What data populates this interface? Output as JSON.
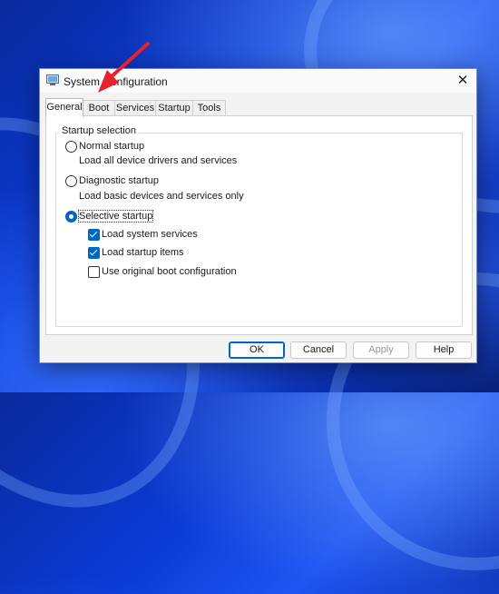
{
  "window": {
    "title": "System Configuration",
    "close_glyph": "✕"
  },
  "tabs": [
    {
      "label": "General",
      "active": true
    },
    {
      "label": "Boot",
      "active": false
    },
    {
      "label": "Services",
      "active": false
    },
    {
      "label": "Startup",
      "active": false
    },
    {
      "label": "Tools",
      "active": false
    }
  ],
  "startup_selection": {
    "group_label": "Startup selection",
    "normal": {
      "label": "Normal startup",
      "description": "Load all device drivers and services",
      "selected": false
    },
    "diagnostic": {
      "label": "Diagnostic startup",
      "description": "Load basic devices and services only",
      "selected": false
    },
    "selective": {
      "label": "Selective startup",
      "selected": true
    },
    "options": [
      {
        "label": "Load system services",
        "checked": true
      },
      {
        "label": "Load startup items",
        "checked": true
      },
      {
        "label": "Use original boot configuration",
        "checked": false
      }
    ]
  },
  "buttons": {
    "ok": "OK",
    "cancel": "Cancel",
    "apply": "Apply",
    "help": "Help"
  },
  "annotation": {
    "color": "#e8212e",
    "icon": "red-arrow-icon"
  }
}
